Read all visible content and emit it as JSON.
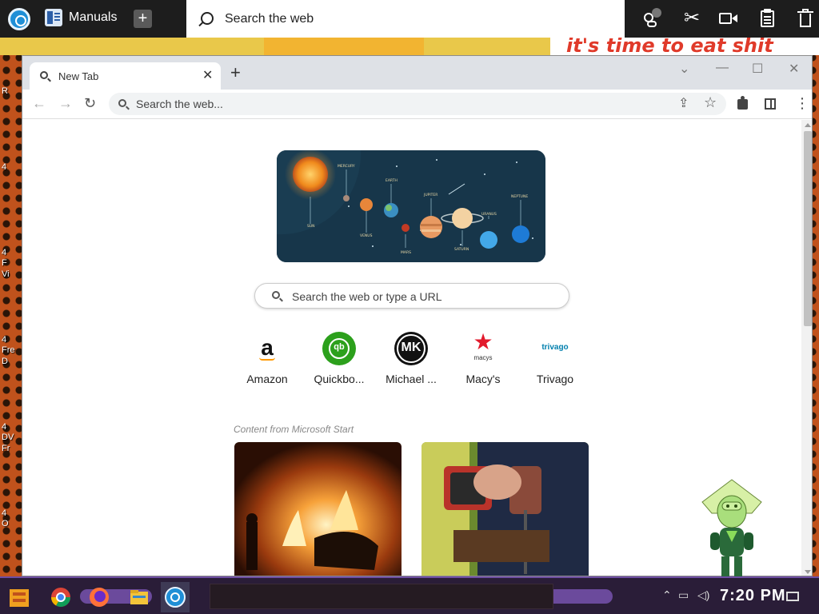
{
  "topbar": {
    "app_title": "Manuals",
    "search_placeholder": "Search the web"
  },
  "wallpaper": {
    "meme_text": "it's time to eat shit"
  },
  "desktop_labels": [
    "R",
    "4",
    "4",
    "F",
    "Vi",
    "4",
    "Fre",
    "D",
    "4",
    "DV",
    "Fr",
    "4",
    "O"
  ],
  "browser": {
    "tab_title": "New Tab",
    "address_placeholder": "Search the web...",
    "ntp_search_placeholder": "Search the web or type a URL",
    "shortcuts": [
      {
        "label": "Amazon",
        "icon": "amazon-icon"
      },
      {
        "label": "Quickbo...",
        "icon": "quickbooks-icon"
      },
      {
        "label": "Michael ...",
        "icon": "michael-kors-icon"
      },
      {
        "label": "Macy's",
        "icon": "macys-icon"
      },
      {
        "label": "Trivago",
        "icon": "trivago-icon"
      }
    ],
    "icon_text": {
      "amazon": "a",
      "quickbooks": "qb",
      "michael_kors": "MK",
      "macys": "macys",
      "trivago": "trivago"
    },
    "content_label": "Content from Microsoft Start",
    "doodle_labels": {
      "sun": "SUN",
      "mercury": "MERCURY",
      "venus": "VENUS",
      "earth": "EARTH",
      "mars": "MARS",
      "jupiter": "JUPITER",
      "saturn": "SATURN",
      "uranus": "URANUS",
      "neptune": "NEPTUNE"
    }
  },
  "taskbar": {
    "clock": "7:20 PM"
  },
  "colors": {
    "accent_blue": "#1a73e8",
    "quickbooks_green": "#2ca01c",
    "macys_red": "#e21a2c",
    "taskbar_purple": "#6b4a9c"
  }
}
